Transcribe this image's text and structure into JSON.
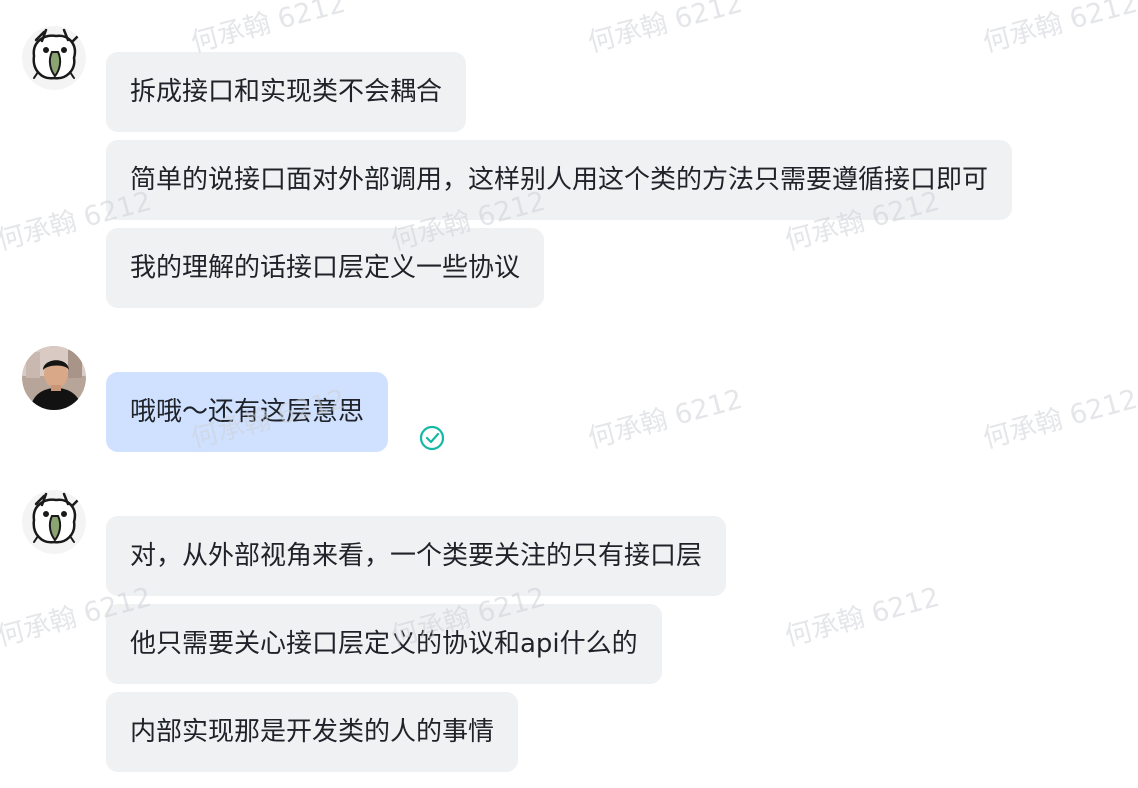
{
  "watermark": "何承翰 6212",
  "groups": [
    {
      "sender": "other",
      "avatar": "bird-avatar",
      "messages": [
        "拆成接口和实现类不会耦合",
        "简单的说接口面对外部调用，这样别人用这个类的方法只需要遵循接口即可",
        "我的理解的话接口层定义一些协议"
      ]
    },
    {
      "sender": "self",
      "avatar": "person-avatar",
      "messages": [
        "哦哦～还有这层意思"
      ],
      "status_icon": "read-check-icon"
    },
    {
      "sender": "other",
      "avatar": "bird-avatar",
      "messages": [
        "对，从外部视角来看，一个类要关注的只有接口层",
        "他只需要关心接口层定义的协议和api什么的",
        "内部实现那是开发类的人的事情"
      ]
    }
  ],
  "colors": {
    "incoming_bubble": "#f0f1f3",
    "outgoing_bubble": "#cfe1ff",
    "read_check": "#14b8a6",
    "text": "#1f2329"
  }
}
